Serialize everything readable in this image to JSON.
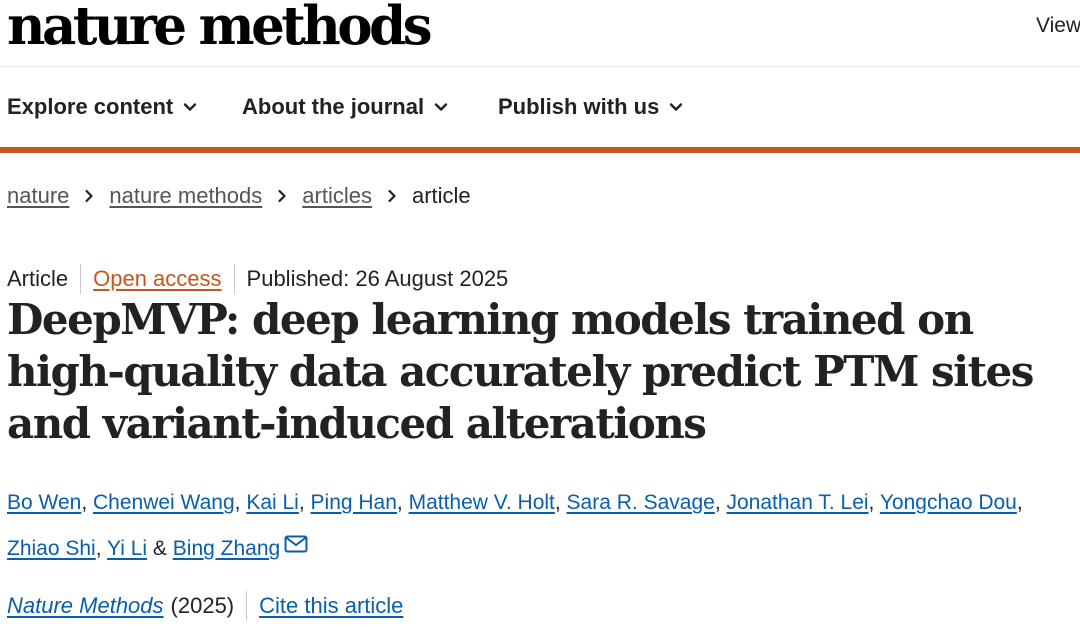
{
  "header": {
    "logo": "nature methods",
    "view_link": "View"
  },
  "nav": {
    "items": [
      {
        "label": "Explore content",
        "icon": "chevron-down-icon"
      },
      {
        "label": "About the journal",
        "icon": "chevron-down-icon"
      },
      {
        "label": "Publish with us",
        "icon": "chevron-down-icon"
      }
    ],
    "accent_color": "#c4561f"
  },
  "breadcrumb": {
    "items": [
      "nature",
      "nature methods",
      "articles"
    ],
    "current": "article",
    "separator_icon": "chevron-right-icon"
  },
  "article": {
    "type": "Article",
    "access": "Open access",
    "published": "Published: 26 August 2025",
    "title": "DeepMVP: deep learning models trained on high-quality data accurately predict PTM sites and variant-induced alterations",
    "authors": [
      "Bo Wen",
      "Chenwei Wang",
      "Kai Li",
      "Ping Han",
      "Matthew V. Holt",
      "Sara R. Savage",
      "Jonathan T. Lei",
      "Yongchao Dou",
      "Zhiao Shi",
      "Yi Li",
      "Bing Zhang"
    ],
    "author_separator": ", ",
    "author_conjunction": " & ",
    "contact_icon": "mail-icon",
    "journal": "Nature Methods",
    "year": "(2025)",
    "cite_link": "Cite this article"
  },
  "colors": {
    "link": "#0a5eae",
    "accent": "#c4561f",
    "text": "#222222"
  }
}
